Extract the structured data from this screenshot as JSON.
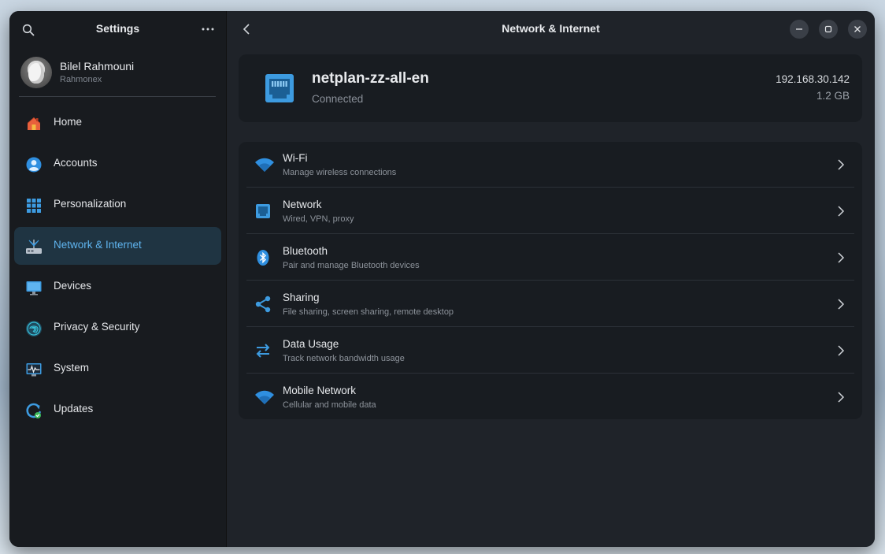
{
  "sidebar": {
    "title": "Settings",
    "profile": {
      "name": "Bilel Rahmouni",
      "username": "Rahmonex"
    },
    "items": [
      {
        "label": "Home",
        "icon": "home-icon"
      },
      {
        "label": "Accounts",
        "icon": "account-icon"
      },
      {
        "label": "Personalization",
        "icon": "grid-icon"
      },
      {
        "label": "Network & Internet",
        "icon": "network-icon",
        "active": true
      },
      {
        "label": "Devices",
        "icon": "monitor-icon"
      },
      {
        "label": "Privacy & Security",
        "icon": "fingerprint-icon"
      },
      {
        "label": "System",
        "icon": "system-monitor-icon"
      },
      {
        "label": "Updates",
        "icon": "update-icon"
      }
    ]
  },
  "header": {
    "title": "Network & Internet"
  },
  "connection": {
    "name": "netplan-zz-all-en",
    "status": "Connected",
    "ip": "192.168.30.142",
    "usage": "1.2 GB"
  },
  "rows": [
    {
      "title": "Wi-Fi",
      "subtitle": "Manage wireless connections",
      "icon": "wifi-icon"
    },
    {
      "title": "Network",
      "subtitle": "Wired, VPN, proxy",
      "icon": "ethernet-icon"
    },
    {
      "title": "Bluetooth",
      "subtitle": "Pair and manage Bluetooth devices",
      "icon": "bluetooth-icon"
    },
    {
      "title": "Sharing",
      "subtitle": "File sharing, screen sharing, remote desktop",
      "icon": "share-icon"
    },
    {
      "title": "Data Usage",
      "subtitle": "Track network bandwidth usage",
      "icon": "transfer-icon"
    },
    {
      "title": "Mobile Network",
      "subtitle": "Cellular and mobile data",
      "icon": "wifi-icon"
    }
  ],
  "colors": {
    "accent": "#3d9be0",
    "active_bg": "#1f3442"
  }
}
